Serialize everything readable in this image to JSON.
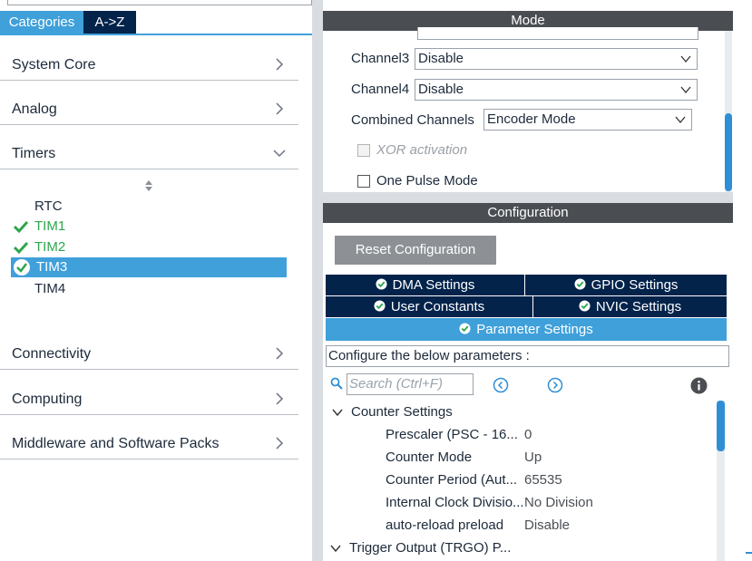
{
  "left": {
    "tabs": [
      {
        "label": "Categories",
        "active": true
      },
      {
        "label": "A->Z",
        "active": false
      }
    ],
    "categories": [
      {
        "label": "System Core",
        "expanded": false
      },
      {
        "label": "Analog",
        "expanded": false
      },
      {
        "label": "Timers",
        "expanded": true
      },
      {
        "label": "Connectivity",
        "expanded": false
      },
      {
        "label": "Computing",
        "expanded": false
      },
      {
        "label": "Middleware and Software Packs",
        "expanded": false
      }
    ],
    "timers": [
      {
        "label": "RTC",
        "state": "plain"
      },
      {
        "label": "TIM1",
        "state": "ok"
      },
      {
        "label": "TIM2",
        "state": "ok"
      },
      {
        "label": "TIM3",
        "state": "selected"
      },
      {
        "label": "TIM4",
        "state": "plain"
      }
    ]
  },
  "mode": {
    "title": "Mode",
    "channel3": {
      "label": "Channel3",
      "value": "Disable"
    },
    "channel4": {
      "label": "Channel4",
      "value": "Disable"
    },
    "combined": {
      "label": "Combined Channels",
      "value": "Encoder Mode"
    },
    "xor": {
      "label": "XOR activation",
      "checked": false,
      "disabled": true
    },
    "one_pulse": {
      "label": "One Pulse Mode",
      "checked": false
    }
  },
  "configuration": {
    "title": "Configuration",
    "reset_label": "Reset Configuration",
    "tabs": {
      "dma": "DMA Settings",
      "gpio": "GPIO Settings",
      "user_constants": "User Constants",
      "nvic": "NVIC Settings",
      "parameter": "Parameter Settings"
    },
    "description": "Configure the below parameters :",
    "search_placeholder": "Search (Ctrl+F)",
    "groups": {
      "counter": "Counter Settings",
      "trgo": "Trigger Output (TRGO) P..."
    },
    "params": [
      {
        "name": "Prescaler (PSC - 16...",
        "value": "0"
      },
      {
        "name": "Counter Mode",
        "value": "Up"
      },
      {
        "name": "Counter Period (Aut...",
        "value": "65535"
      },
      {
        "name": "Internal Clock Divisio...",
        "value": "No Division"
      },
      {
        "name": "auto-reload preload",
        "value": "Disable"
      }
    ]
  },
  "colors": {
    "accent": "#3fa0da",
    "navy": "#03234b",
    "ok_green": "#2da64c",
    "header_bar": "#4a4e52"
  }
}
